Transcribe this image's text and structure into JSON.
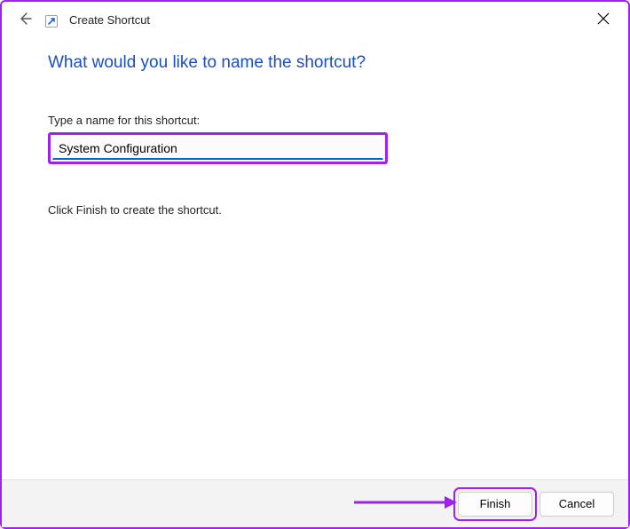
{
  "header": {
    "title": "Create Shortcut"
  },
  "main": {
    "heading": "What would you like to name the shortcut?",
    "input_label": "Type a name for this shortcut:",
    "input_value": "System Configuration",
    "instruction": "Click Finish to create the shortcut."
  },
  "buttons": {
    "finish": "Finish",
    "cancel": "Cancel"
  },
  "icons": {
    "close": "close-icon",
    "back": "back-arrow-icon",
    "shortcut": "shortcut-arrow-icon"
  },
  "annotation": {
    "highlight_color": "#a020f0",
    "accent_color": "#0067c0"
  }
}
